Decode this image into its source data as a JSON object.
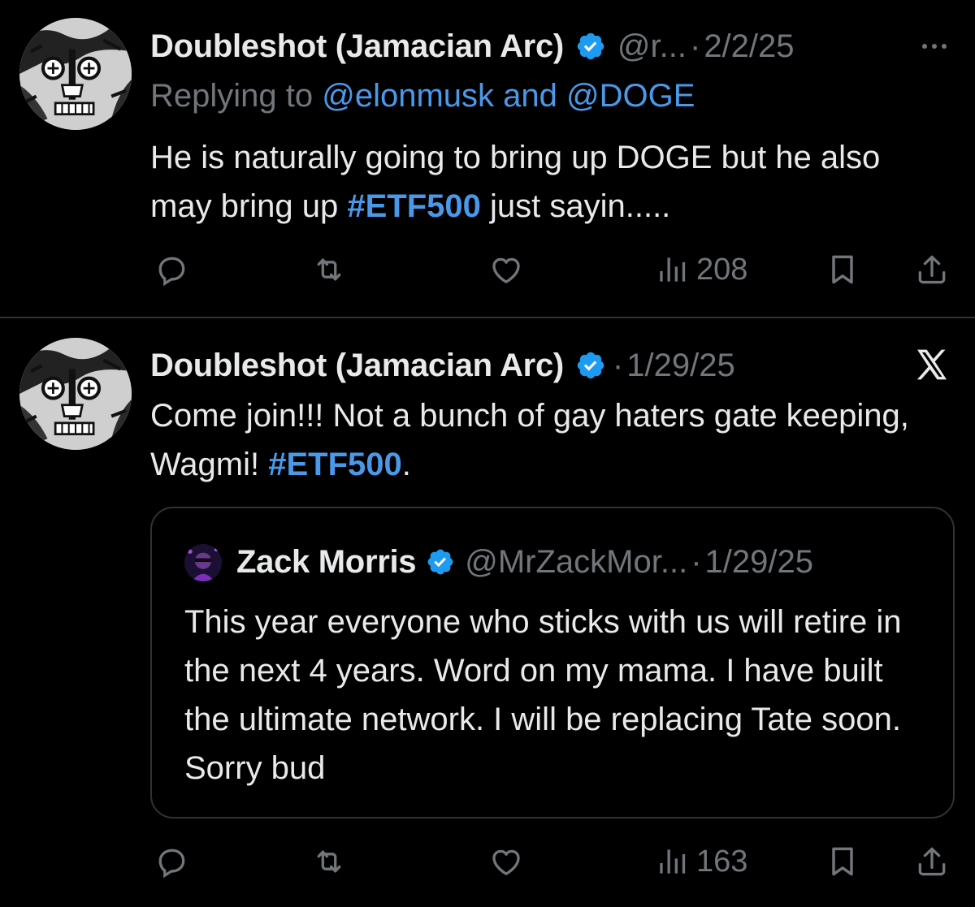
{
  "tweets": [
    {
      "author_name": "Doubleshot (Jamacian Arc)",
      "handle": "@r...",
      "separator": "·",
      "date": "2/2/25",
      "replying_prefix": "Replying to ",
      "replying_mentions": "@elonmusk and @DOGE",
      "text_part1": "He is naturally going to bring up DOGE but he also may bring up ",
      "hashtag": "#ETF500",
      "text_part2": " just sayin.....",
      "views": "208",
      "more_icon": "more-horizontal-icon"
    },
    {
      "author_name": "Doubleshot (Jamacian Arc)",
      "separator": "·",
      "date": "1/29/25",
      "text_part1": "Come join!!! Not a bunch of gay haters gate keeping, Wagmi! ",
      "hashtag": "#ETF500",
      "text_part2": ".",
      "views": "163",
      "corner_icon": "x-logo-icon",
      "quote": {
        "author_name": "Zack Morris",
        "handle": "@MrZackMor...",
        "separator": "·",
        "date": "1/29/25",
        "text": "This year everyone who sticks with us will retire in the next 4 years. Word on my mama. I have built the ultimate network. I will be replacing Tate soon. Sorry bud"
      }
    }
  ],
  "colors": {
    "background": "#000000",
    "text": "#e7e9ea",
    "muted": "#71767b",
    "accent": "#4a99e9",
    "divider": "#2f3336"
  },
  "icons": [
    "reply-icon",
    "retweet-icon",
    "like-icon",
    "views-icon",
    "bookmark-icon",
    "share-icon",
    "verified-badge-icon"
  ]
}
